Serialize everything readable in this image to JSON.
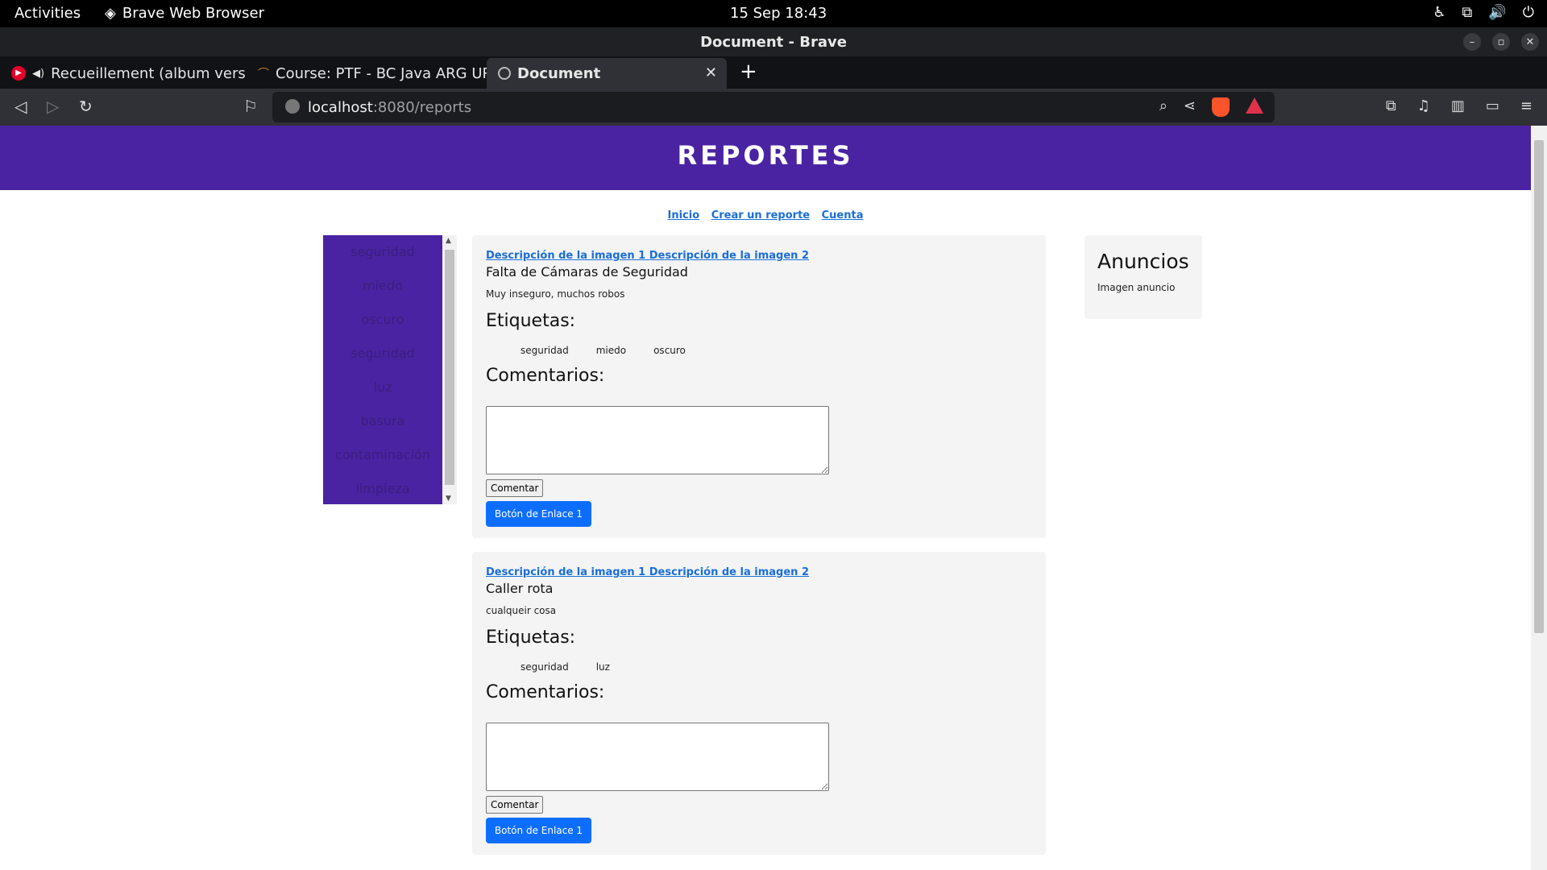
{
  "system": {
    "activities": "Activities",
    "app_name": "Brave Web Browser",
    "clock": "15 Sep  18:43"
  },
  "window": {
    "title": "Document - Brave"
  },
  "tabs": [
    {
      "label": "Recueillement (album vers",
      "icon": "youtube-icon",
      "active": false
    },
    {
      "label": "Course: PTF - BC Java ARG UR",
      "icon": "course-icon",
      "active": false
    },
    {
      "label": "Document",
      "icon": "globe-icon",
      "active": true
    }
  ],
  "address": {
    "host": "localhost",
    "path": ":8080/reports"
  },
  "page": {
    "header": "REPORTES",
    "nav": [
      "Inicio",
      "Crear un reporte",
      "Cuenta"
    ],
    "sidebar": [
      "seguridad",
      "miedo",
      "oscuro",
      "seguridad",
      "luz",
      "basura",
      "contaminación",
      "limpieza"
    ],
    "labels": {
      "img1": "Descripción de la imagen 1",
      "img2": "Descripción de la imagen 2",
      "tags_heading": "Etiquetas:",
      "comments_heading": "Comentarios:",
      "comment_button": "Comentar",
      "link_button": "Botón de Enlace 1"
    },
    "reports": [
      {
        "title": "Falta de Cámaras de Seguridad",
        "description": "Muy inseguro, muchos robos",
        "tags": [
          "seguridad",
          "miedo",
          "oscuro"
        ]
      },
      {
        "title": "Caller rota",
        "description": "cualqueir cosa",
        "tags": [
          "seguridad",
          "luz"
        ]
      }
    ],
    "ads": {
      "heading": "Anuncios",
      "image_alt": "Imagen anuncio"
    }
  },
  "colors": {
    "header": "#4a23a3",
    "link": "#1a6ed8",
    "button": "#0d6efd"
  }
}
